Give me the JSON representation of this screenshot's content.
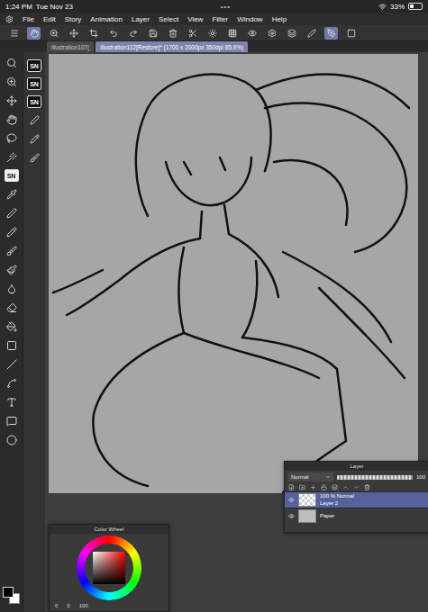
{
  "status_bar": {
    "time": "1:24 PM",
    "date": "Tue Nov 23",
    "dots": "•••",
    "battery": "33%",
    "battery_level": 0.33
  },
  "menu": [
    "File",
    "Edit",
    "Story",
    "Animation",
    "Layer",
    "Select",
    "View",
    "Filter",
    "Window",
    "Help"
  ],
  "tabs": [
    {
      "label": "illustration107(",
      "selected": false
    },
    {
      "label": "illustration112[Restore]* (1700 x 2000px 350dpi 85.9%)",
      "selected": true
    }
  ],
  "sub_tools": [
    {
      "label": "SN",
      "selected": false
    },
    {
      "label": "SN",
      "selected": false
    },
    {
      "label": "SN",
      "selected": false
    }
  ],
  "brush_tool": {
    "label": "SN",
    "selected": true
  },
  "layer_panel": {
    "title": "Layer",
    "blend_mode": "Normal",
    "opacity": "100",
    "opacity_level": 1,
    "layers": [
      {
        "mode": "100 % Normal",
        "name": "Layer 2",
        "visible": true,
        "selected": true
      },
      {
        "name": "Paper",
        "visible": true,
        "selected": false
      }
    ]
  },
  "color_wheel": {
    "title": "Color Wheel",
    "values": [
      "0",
      "0",
      "100"
    ]
  }
}
